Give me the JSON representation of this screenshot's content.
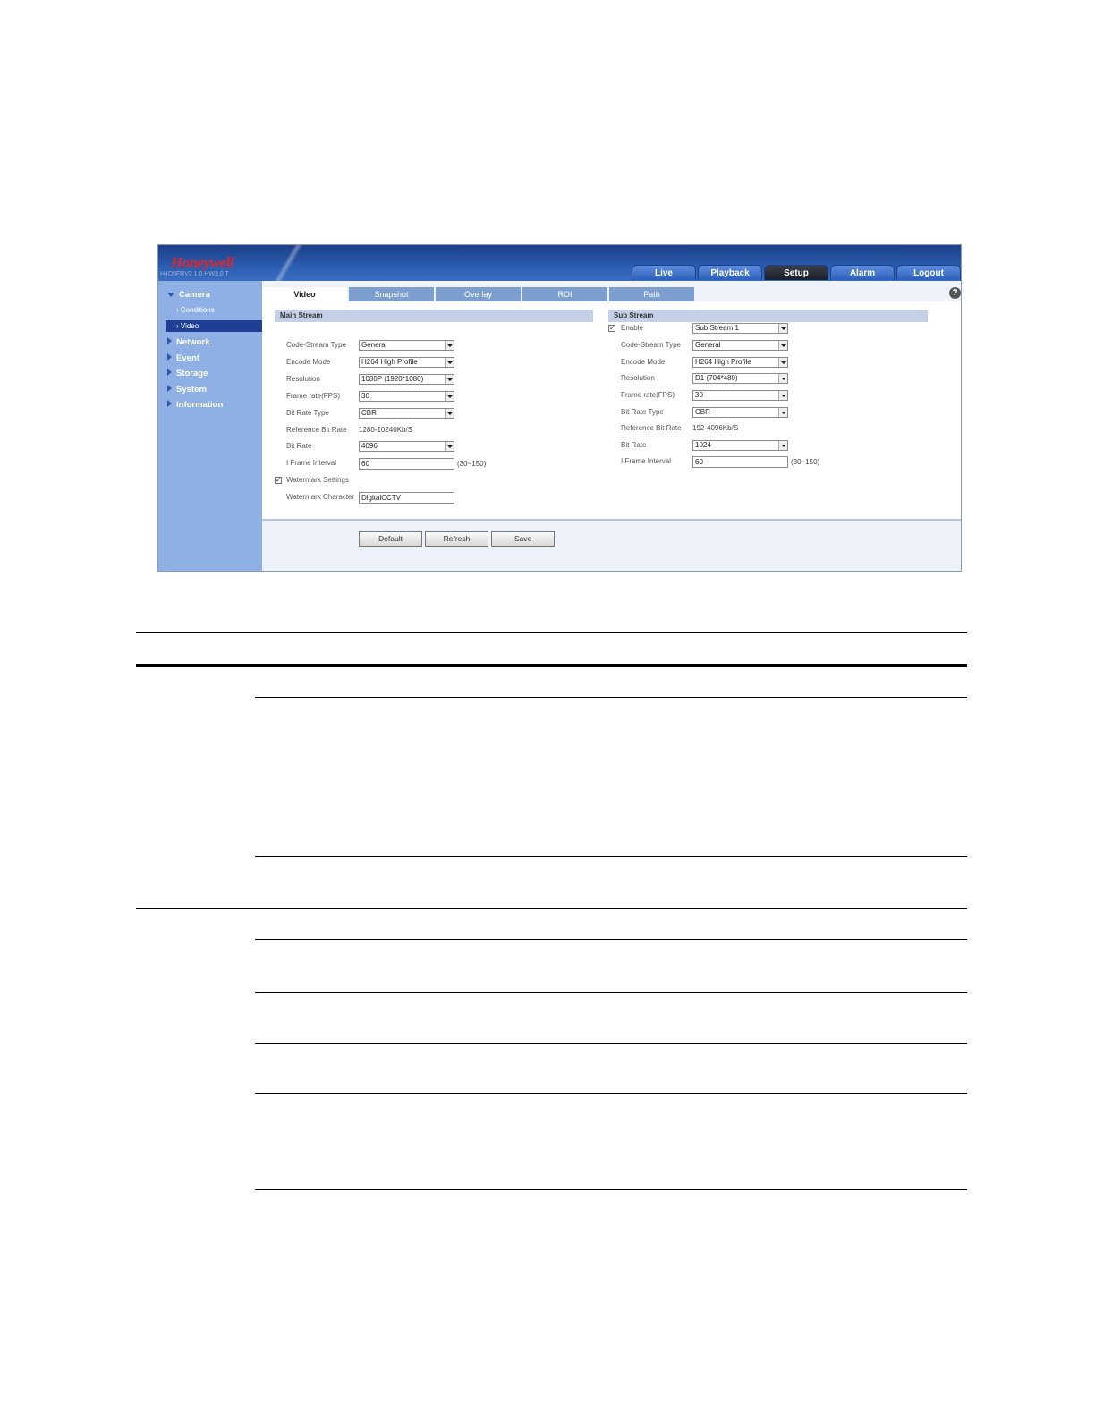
{
  "header": {
    "logo": "Honeywell",
    "model": "H4D5FRV2 1.0 HW3.0 T",
    "nav": [
      {
        "label": "Live",
        "active": false
      },
      {
        "label": "Playback",
        "active": false
      },
      {
        "label": "Setup",
        "active": true
      },
      {
        "label": "Alarm",
        "active": false
      },
      {
        "label": "Logout",
        "active": false
      }
    ]
  },
  "sidebar": {
    "camera": "Camera",
    "conditions": "Conditions",
    "video": "Video",
    "network": "Network",
    "event": "Event",
    "storage": "Storage",
    "system": "System",
    "information": "Information"
  },
  "tabs": [
    "Video",
    "Snapshot",
    "Overlay",
    "ROI",
    "Path"
  ],
  "help_icon": "?",
  "main_stream": {
    "title": "Main Stream",
    "code_stream_type": {
      "label": "Code-Stream Type",
      "value": "General"
    },
    "encode_mode": {
      "label": "Encode Mode",
      "value": "H264 High Profile"
    },
    "resolution": {
      "label": "Resolution",
      "value": "1080P (1920*1080)"
    },
    "frame_rate": {
      "label": "Frame rate(FPS)",
      "value": "30"
    },
    "bit_rate_type": {
      "label": "Bit Rate Type",
      "value": "CBR"
    },
    "reference_bit_rate": {
      "label": "Reference Bit Rate",
      "value": "1280-10240Kb/S"
    },
    "bit_rate": {
      "label": "Bit Rate",
      "value": "4096"
    },
    "i_frame_interval": {
      "label": "I Frame Interval",
      "value": "60",
      "range": "(30~150)"
    },
    "watermark_settings": {
      "label": "Watermark Settings",
      "checked": true
    },
    "watermark_character": {
      "label": "Watermark Character",
      "value": "DigitalCCTV"
    }
  },
  "sub_stream": {
    "title": "Sub Stream",
    "enable": {
      "label": "Enable",
      "checked": true,
      "value": "Sub Stream 1"
    },
    "code_stream_type": {
      "label": "Code-Stream Type",
      "value": "General"
    },
    "encode_mode": {
      "label": "Encode Mode",
      "value": "H264 High Profile"
    },
    "resolution": {
      "label": "Resolution",
      "value": "D1 (704*480)"
    },
    "frame_rate": {
      "label": "Frame rate(FPS)",
      "value": "30"
    },
    "bit_rate_type": {
      "label": "Bit Rate Type",
      "value": "CBR"
    },
    "reference_bit_rate": {
      "label": "Reference Bit Rate",
      "value": "192-4096Kb/S"
    },
    "bit_rate": {
      "label": "Bit Rate",
      "value": "1024"
    },
    "i_frame_interval": {
      "label": "I Frame Interval",
      "value": "60",
      "range": "(30~150)"
    }
  },
  "buttons": {
    "default": "Default",
    "refresh": "Refresh",
    "save": "Save"
  },
  "checkmark": "✓"
}
